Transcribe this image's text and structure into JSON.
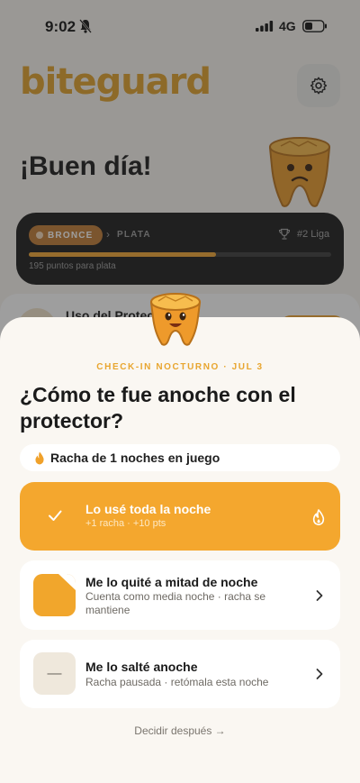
{
  "status": {
    "time": "9:02",
    "network": "4G"
  },
  "app": {
    "logo": "biteguard",
    "greeting": "¡Buen día!"
  },
  "league": {
    "current_badge": "BRONCE",
    "next_badge": "PLATA",
    "rank": "#2 Liga",
    "progress_fraction": 0.62,
    "points_text": "195 puntos para plata"
  },
  "usage_card": {
    "title": "Uso del Protector"
  },
  "checkin": {
    "eyebrow": "CHECK-IN NOCTURNO · JUL 3",
    "question": "¿Cómo te fue anoche con el protector?",
    "streak_text": "Racha de 1 noches en juego",
    "options": [
      {
        "title": "Lo usé toda la noche",
        "subtitle": "+1 racha · +10 pts",
        "icon": "check-icon",
        "selected": true
      },
      {
        "title": "Me lo quité a mitad de noche",
        "subtitle": "Cuenta como media noche · racha se mantiene",
        "icon": "half-moon-icon",
        "selected": false
      },
      {
        "title": "Me lo salté anoche",
        "subtitle": "Racha pausada · retómala esta noche",
        "icon": "dash-icon",
        "dash_glyph": "—",
        "selected": false
      }
    ],
    "later_text": "Decidir después →"
  },
  "colors": {
    "accent": "#f4a72e",
    "logo": "#e0a12a",
    "sheet_bg": "#faf7f2",
    "dark_card": "#1a1a1a"
  }
}
